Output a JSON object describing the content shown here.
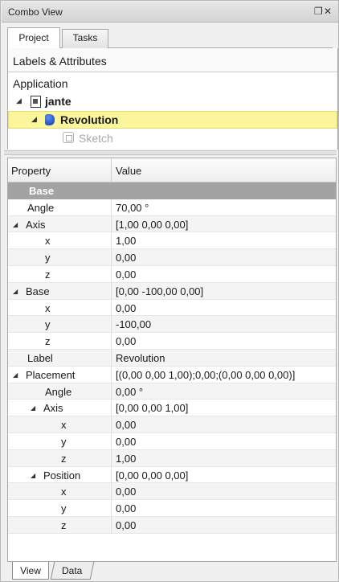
{
  "window": {
    "title": "Combo View",
    "controls": [
      "restore-icon",
      "close-icon"
    ]
  },
  "top_tabs": [
    {
      "label": "Project",
      "active": true
    },
    {
      "label": "Tasks",
      "active": false
    }
  ],
  "tree": {
    "header": "Labels & Attributes",
    "root_label": "Application",
    "items": [
      {
        "label": "jante",
        "icon": "document-icon",
        "expanded": true,
        "bold": true
      },
      {
        "label": "Revolution",
        "icon": "revolution-icon",
        "expanded": true,
        "bold": true,
        "selected": true
      },
      {
        "label": "Sketch",
        "icon": "sketch-icon",
        "disabled": true
      }
    ]
  },
  "property_table": {
    "columns": [
      "Property",
      "Value"
    ],
    "rows": [
      {
        "name": "Base",
        "value": "",
        "type": "group"
      },
      {
        "name": "Angle",
        "value": "70,00 °"
      },
      {
        "name": "Axis",
        "value": "[1,00 0,00 0,00]",
        "expandable": true
      },
      {
        "name": "x",
        "value": "1,00"
      },
      {
        "name": "y",
        "value": "0,00"
      },
      {
        "name": "z",
        "value": "0,00"
      },
      {
        "name": "Base",
        "value": "[0,00 -100,00 0,00]",
        "expandable": true
      },
      {
        "name": "x",
        "value": "0,00"
      },
      {
        "name": "y",
        "value": "-100,00"
      },
      {
        "name": "z",
        "value": "0,00"
      },
      {
        "name": "Label",
        "value": "Revolution"
      },
      {
        "name": "Placement",
        "value": "[(0,00 0,00 1,00);0,00;(0,00 0,00 0,00)]",
        "expandable": true
      },
      {
        "name": "Angle",
        "value": "0,00 °"
      },
      {
        "name": "Axis",
        "value": "[0,00 0,00 1,00]",
        "expandable": true
      },
      {
        "name": "x",
        "value": "0,00"
      },
      {
        "name": "y",
        "value": "0,00"
      },
      {
        "name": "z",
        "value": "1,00"
      },
      {
        "name": "Position",
        "value": "[0,00 0,00 0,00]",
        "expandable": true
      },
      {
        "name": "x",
        "value": "0,00"
      },
      {
        "name": "y",
        "value": "0,00"
      },
      {
        "name": "z",
        "value": "0,00"
      }
    ]
  },
  "bottom_tabs": [
    {
      "label": "View",
      "active": true
    },
    {
      "label": "Data",
      "active": false
    }
  ]
}
